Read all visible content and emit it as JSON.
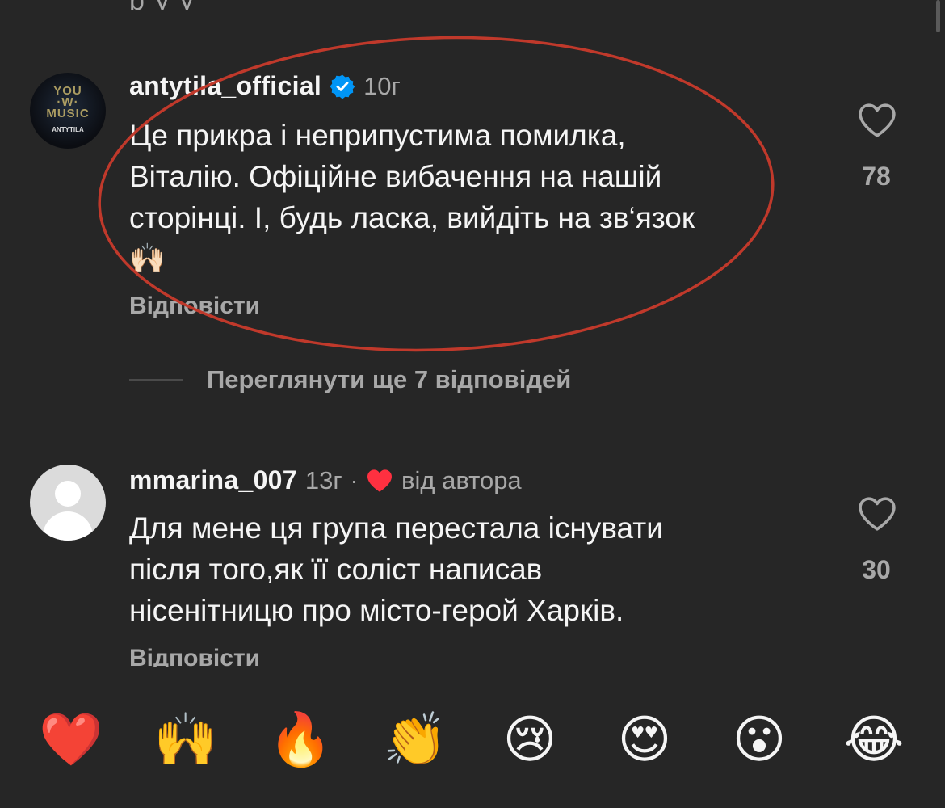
{
  "top_clipped_text": "p        y              y",
  "comments": [
    {
      "username": "antytila_official",
      "verified": true,
      "time": "10г",
      "text_lines": [
        "Це прикра і неприпустима помилка,",
        "Віталію. Офіційне вибачення на нашій",
        "сторінці. І, будь ласка, вийдіть на зв‘язок",
        "🙌🏻"
      ],
      "reply_label": "Відповісти",
      "like_count": "78",
      "view_more_label": "Переглянути ще 7 відповідей",
      "avatar_icon": "band-logo-avatar"
    },
    {
      "username": "mmarina_007",
      "time": "13г",
      "separator": "·",
      "author_like_label": "від автора",
      "text_lines": [
        "Для мене ця група перестала існувати",
        "після того,як її соліст написав",
        "нісенітницю про місто-герой Харків."
      ],
      "reply_label": "Відповісти",
      "like_count": "30",
      "avatar_icon": "default-user-avatar"
    }
  ],
  "reactions": [
    {
      "name": "red-heart",
      "glyph": "❤️"
    },
    {
      "name": "raising-hands",
      "glyph": "🙌"
    },
    {
      "name": "fire",
      "glyph": "🔥"
    },
    {
      "name": "clapping-hands",
      "glyph": "👏"
    },
    {
      "name": "crying-face",
      "glyph": "😢"
    },
    {
      "name": "heart-eyes",
      "glyph": "😍"
    },
    {
      "name": "astonished-face",
      "glyph": "😮"
    },
    {
      "name": "tears-of-joy",
      "glyph": "😂"
    }
  ],
  "colors": {
    "background": "#262626",
    "text_primary": "#f5f5f5",
    "text_secondary": "#a8a8a8",
    "verified_blue": "#0095f6",
    "author_heart": "#ff3040",
    "annotation_red": "#c0392b"
  }
}
